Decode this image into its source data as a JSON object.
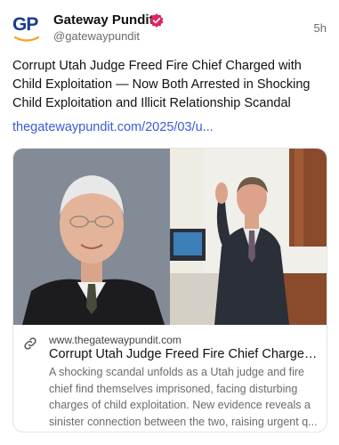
{
  "post": {
    "author_name": "Gateway Pundit",
    "handle": "@gatewaypundit",
    "time": "5h",
    "avatar_text": "GP",
    "text": "Corrupt Utah Judge Freed Fire Chief Charged with Child Exploitation — Now Both Arrested in Shocking Child Exploitation and Illicit Relationship Scandal",
    "link": "thegatewaypundit.com/2025/03/u..."
  },
  "card": {
    "domain": "www.thegatewaypundit.com",
    "title": "Corrupt Utah Judge Freed Fire Chief Charged ...",
    "description": "A shocking scandal unfolds as a Utah judge and fire chief find themselves imprisoned, facing disturbing charges of child exploitation. New evidence reveals a sinister connection between the two, raising urgent q..."
  },
  "icons": {
    "verified": "verified-badge-icon",
    "link": "link-icon"
  },
  "colors": {
    "brand_blue": "#1a3a8f",
    "brand_orange": "#f5a623",
    "verified_pink": "#e0245e",
    "link_blue": "#3b5bdb",
    "muted_gray": "#6b6b6b"
  }
}
